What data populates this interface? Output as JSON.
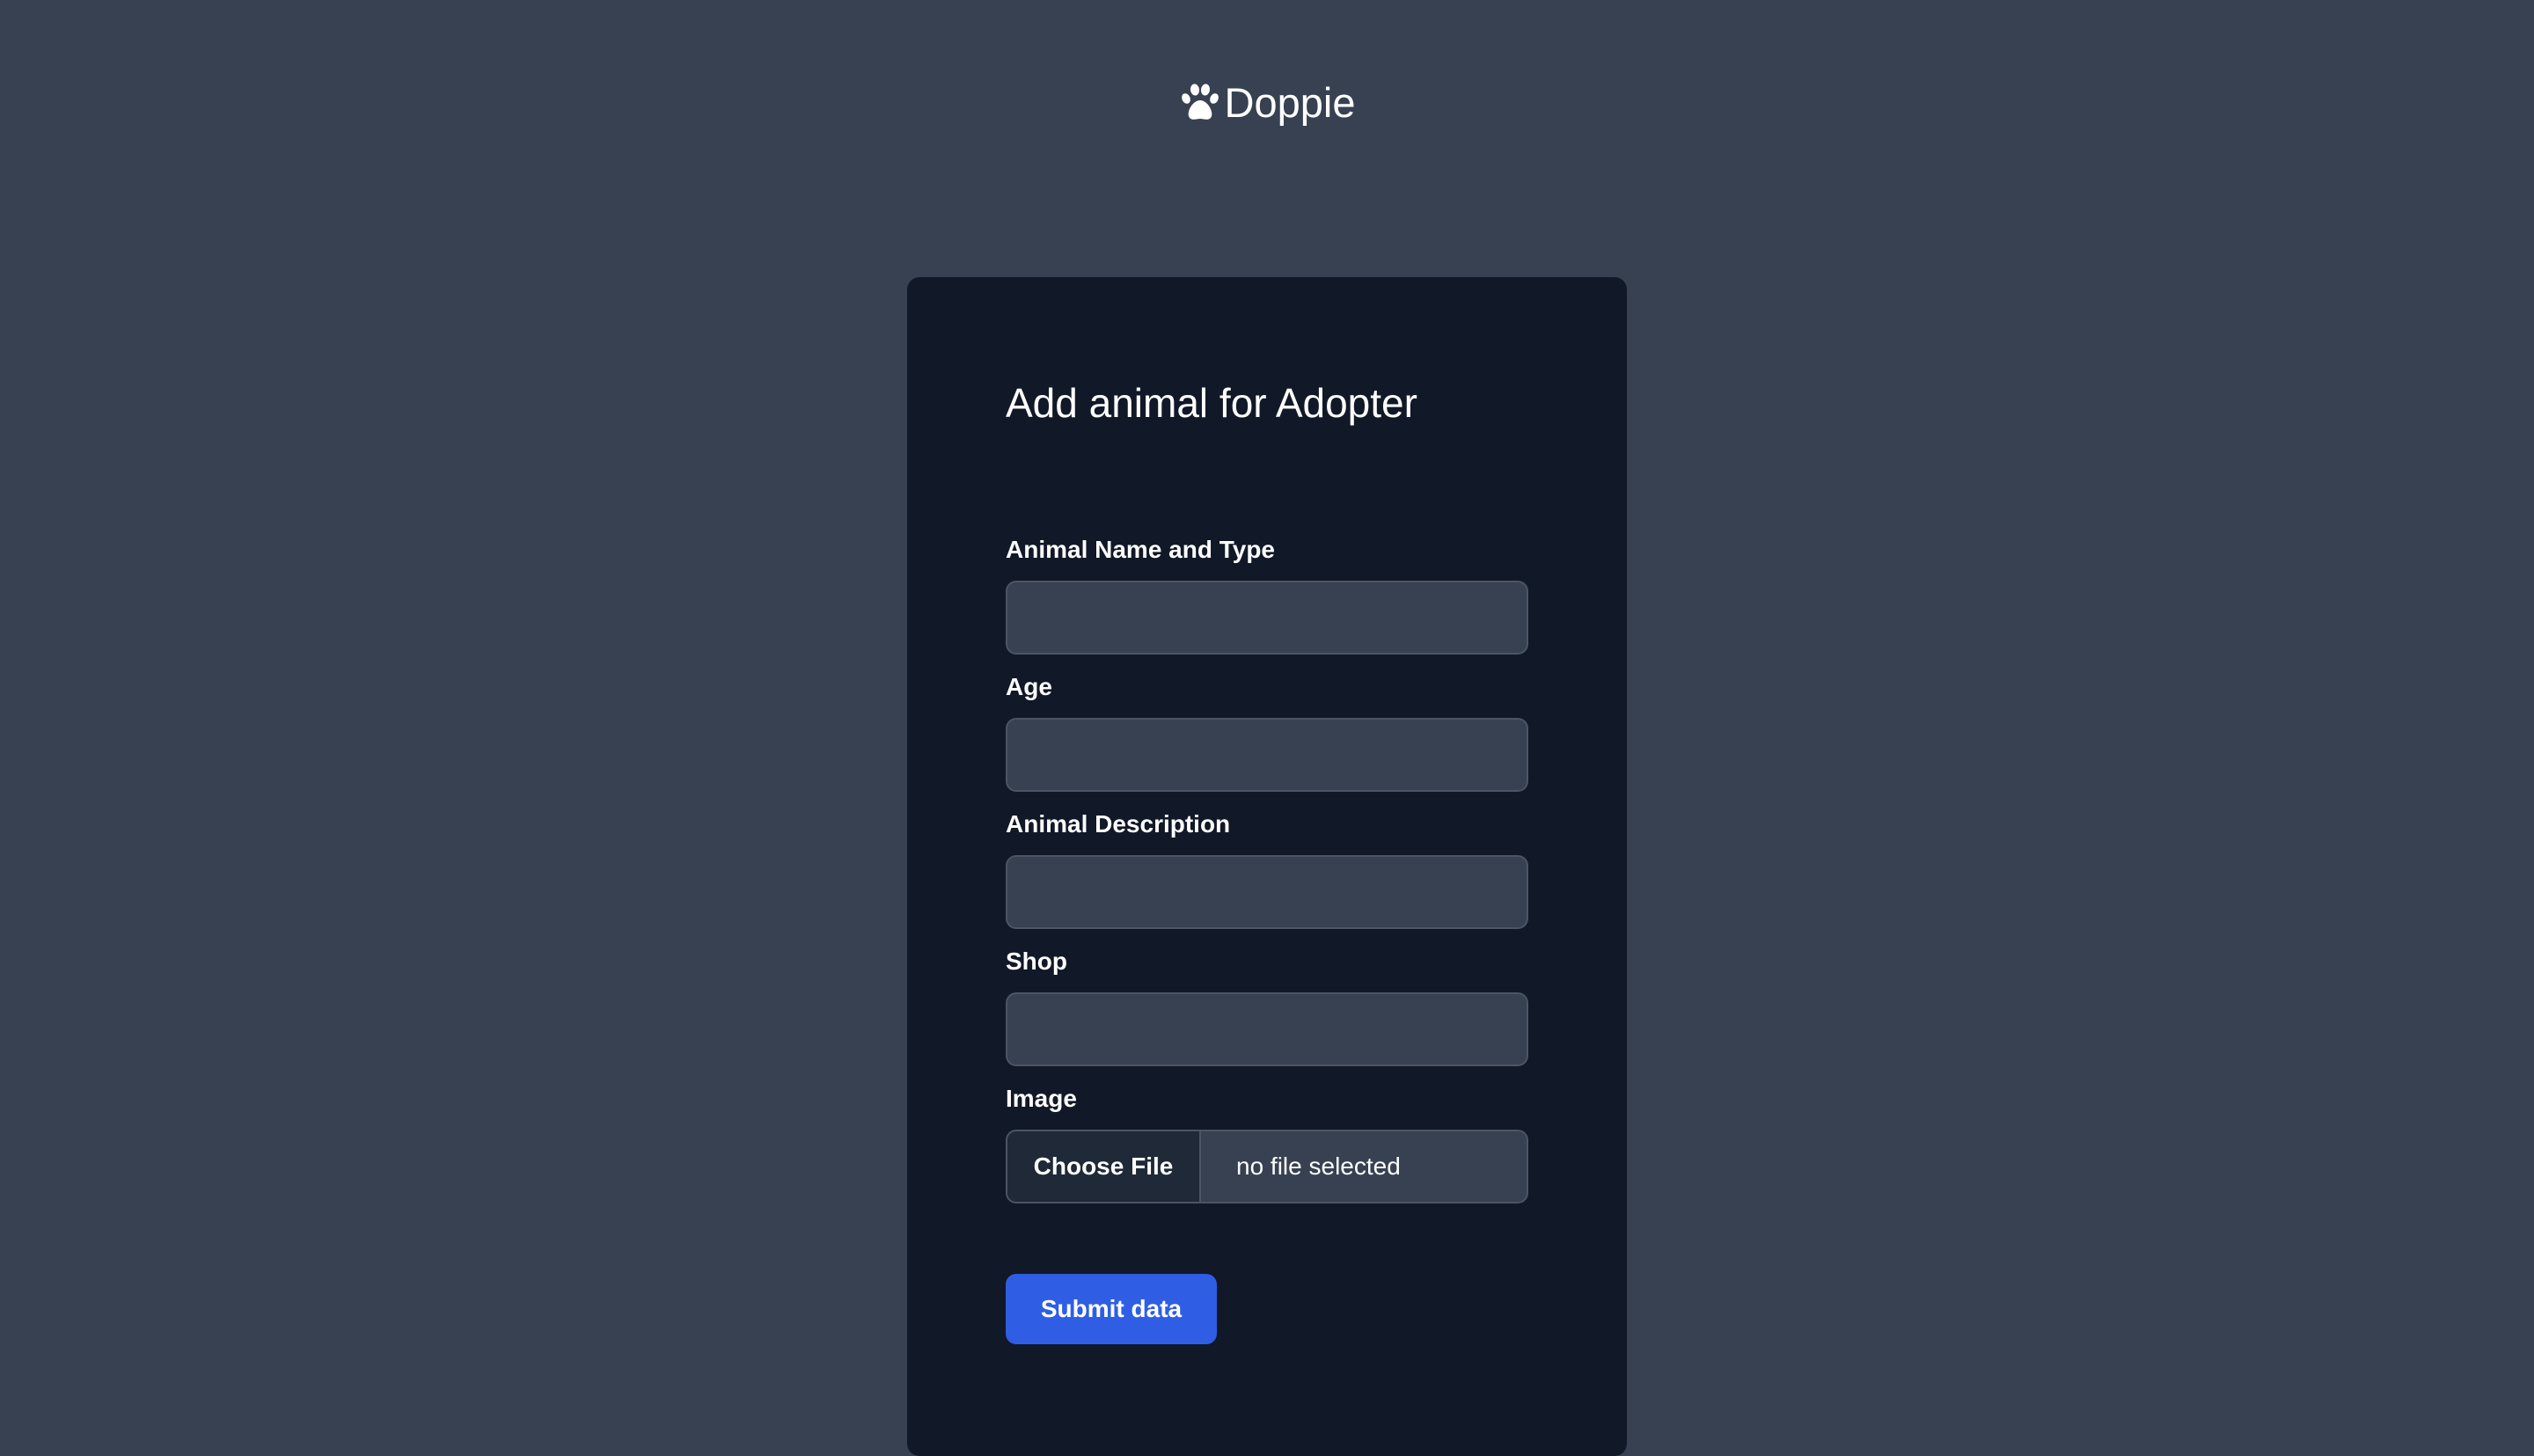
{
  "header": {
    "brand_name": "Doppie",
    "logo_icon": "paw-icon"
  },
  "form": {
    "title": "Add animal for Adopter",
    "fields": [
      {
        "label": "Animal Name and Type",
        "value": "",
        "placeholder": ""
      },
      {
        "label": "Age",
        "value": "",
        "placeholder": ""
      },
      {
        "label": "Animal Description",
        "value": "",
        "placeholder": ""
      },
      {
        "label": "Shop",
        "value": "",
        "placeholder": ""
      }
    ],
    "image": {
      "label": "Image",
      "button_label": "Choose File",
      "status": "no file selected"
    },
    "submit_label": "Submit data"
  },
  "colors": {
    "page_background": "#374151",
    "card_background": "#111827",
    "input_background": "#374151",
    "accent": "#2f5ee5"
  }
}
